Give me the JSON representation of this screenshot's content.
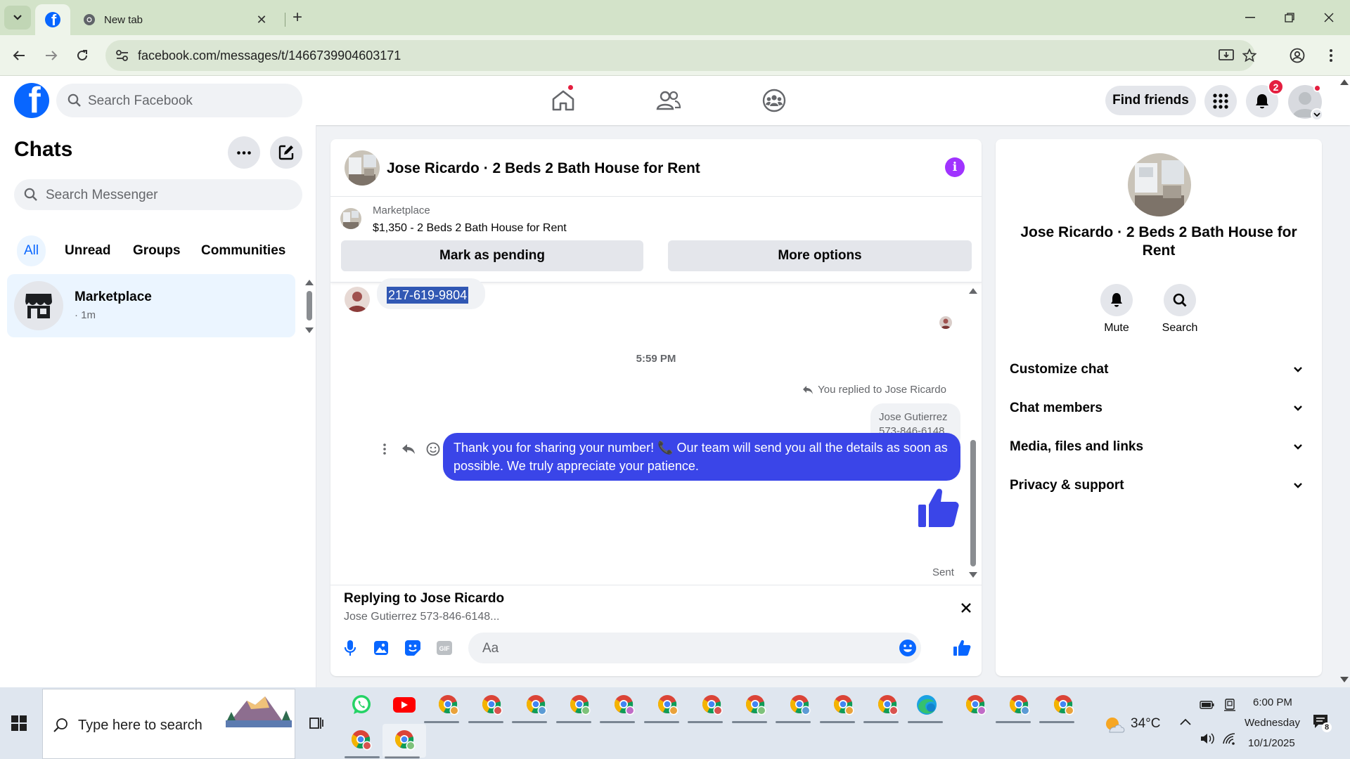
{
  "browser": {
    "tabs": [
      {
        "title": ""
      },
      {
        "title": "New tab"
      }
    ],
    "url": "facebook.com/messages/t/1466739904603171"
  },
  "fb_header": {
    "search_placeholder": "Search Facebook",
    "find_friends": "Find friends",
    "notifications_count": "2",
    "accent_color": "#0866ff"
  },
  "chats": {
    "title": "Chats",
    "search_placeholder": "Search Messenger",
    "filters": [
      "All",
      "Unread",
      "Groups",
      "Communities"
    ],
    "items": [
      {
        "name": "Marketplace",
        "time": "· 1m"
      }
    ]
  },
  "conversation": {
    "title": "Jose Ricardo · 2 Beds 2 Bath House for Rent",
    "marketplace_label": "Marketplace",
    "listing": "$1,350 - 2 Beds 2 Bath House for Rent",
    "mark_pending": "Mark as pending",
    "more_options": "More options",
    "incoming_phone": "217-619-9804",
    "timestamp": "5:59 PM",
    "replied_to": "You replied to Jose Ricardo",
    "quoted_lines": [
      "Jose Gutierrez",
      "573-846-6148",
      "..."
    ],
    "outgoing_message": "Thank you for sharing your number! 📞 Our team will send you all the details as soon as possible. We truly appreciate your patience.",
    "sent_status": "Sent",
    "replying_title": "Replying to Jose Ricardo",
    "replying_sub": "Jose Gutierrez 573-846-6148...",
    "composer_placeholder": "Aa",
    "bubble_color": "#3a45e8"
  },
  "info_panel": {
    "name": "Jose Ricardo · 2 Beds 2 Bath House for Rent",
    "actions": [
      {
        "label": "Mute",
        "icon": "bell-icon"
      },
      {
        "label": "Search",
        "icon": "search-icon"
      }
    ],
    "sections": [
      "Customize chat",
      "Chat members",
      "Media, files and links",
      "Privacy & support"
    ]
  },
  "taskbar": {
    "search_placeholder": "Type here to search",
    "weather": "34°C",
    "time": "6:00 PM",
    "day": "Wednesday",
    "date": "10/1/2025",
    "notification_count": "8"
  }
}
